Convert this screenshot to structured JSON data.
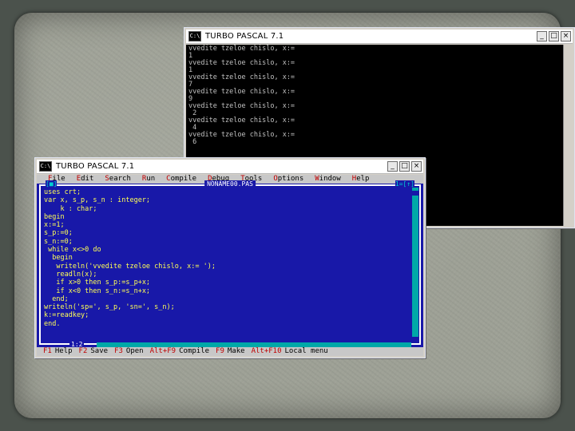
{
  "console": {
    "title": "TURBO PASCAL 7.1",
    "lines": [
      "vvedite tzeloe chislo, x:=",
      "1",
      "vvedite tzeloe chislo, x:=",
      "1",
      "vvedite tzeloe chislo, x:=",
      "7",
      "vvedite tzeloe chislo, x:=",
      "9",
      "vvedite tzeloe chislo, x:=",
      " 2",
      "vvedite tzeloe chislo, x:=",
      " 4",
      "vvedite tzeloe chislo, x:=",
      " 6"
    ]
  },
  "ide": {
    "title": "TURBO PASCAL 7.1",
    "menu": [
      {
        "hot": "F",
        "rest": "ile"
      },
      {
        "hot": "E",
        "rest": "dit"
      },
      {
        "hot": "S",
        "rest": "earch"
      },
      {
        "hot": "R",
        "rest": "un"
      },
      {
        "hot": "C",
        "rest": "ompile"
      },
      {
        "hot": "D",
        "rest": "ebug"
      },
      {
        "hot": "T",
        "rest": "ools"
      },
      {
        "hot": "O",
        "rest": "ptions"
      },
      {
        "hot": "W",
        "rest": "indow"
      },
      {
        "hot": "H",
        "rest": "elp"
      }
    ],
    "editor": {
      "filename": "NONAME00.PAS",
      "left_marker": "[■]",
      "right_marker": "1=[↑]",
      "cursor_position": "1:2",
      "code": [
        "uses crt;",
        "var x, s_p, s_n : integer;",
        "    k : char;",
        "begin",
        "x:=1;",
        "s_p:=0;",
        "s_n:=0;",
        " while x<>0 do",
        "  begin",
        "   writeln('vvedite tzeloe chislo, x:= ');",
        "   readln(x);",
        "   if x>0 then s_p:=s_p+x;",
        "   if x<0 then s_n:=s_n+x;",
        "  end;",
        "writeln('sp=', s_p, 'sn=', s_n);",
        "k:=readkey;",
        "end."
      ]
    },
    "status": [
      {
        "key": "F1",
        "label": "Help"
      },
      {
        "key": "F2",
        "label": "Save"
      },
      {
        "key": "F3",
        "label": "Open"
      },
      {
        "key": "Alt+F9",
        "label": "Compile"
      },
      {
        "key": "F9",
        "label": "Make"
      },
      {
        "key": "Alt+F10",
        "label": "Local menu"
      }
    ]
  }
}
